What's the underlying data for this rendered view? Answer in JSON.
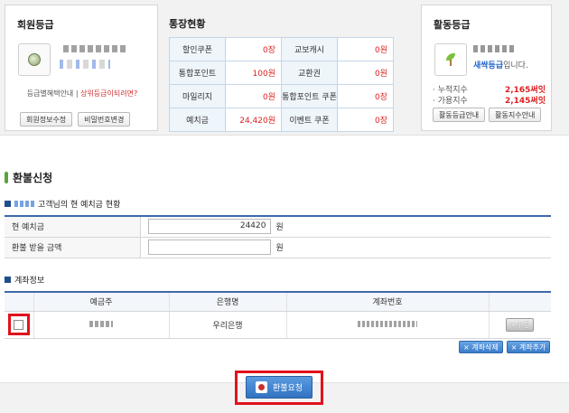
{
  "member_grade": {
    "title": "회원등급",
    "grade_info_link": "등급별혜택안내",
    "separator": "|",
    "upper_grade_link": "상위등급이되려면?",
    "edit_info_button": "회원정보수정",
    "change_password_button": "비밀번호변경"
  },
  "account_status": {
    "title": "통장현황",
    "rows": [
      {
        "label1": "할인쿠폰",
        "value1": "0장",
        "label2": "교보캐시",
        "value2": "0원"
      },
      {
        "label1": "통합포인트",
        "value1": "100원",
        "label2": "교환권",
        "value2": "0원"
      },
      {
        "label1": "마일리지",
        "value1": "0원",
        "label2": "통합포인트 쿠폰",
        "value2": "0장"
      },
      {
        "label1": "예치금",
        "value1": "24,420원",
        "label2": "이벤트 쿠폰",
        "value2": "0장"
      }
    ]
  },
  "activity_grade": {
    "title": "활동등급",
    "grade_name": "새싹등급",
    "grade_suffix": "입니다.",
    "cumulative_label": "· 누적지수",
    "cumulative_value": "2,165써잇",
    "available_label": "· 가용지수",
    "available_value": "2,145써잇",
    "grade_guide_button": "활동등급안내",
    "index_guide_button": "활동지수안내"
  },
  "refund": {
    "section_title": "환불신청",
    "deposit_status_title": "고객님의 현 예치금 현황",
    "current_deposit_label": "현 예치금",
    "current_deposit_value": "24420",
    "refund_amount_label": "환불 받을 금액",
    "refund_amount_value": "",
    "unit": "원"
  },
  "account_info": {
    "title": "계좌정보",
    "headers": [
      "예금주",
      "은행명",
      "계좌번호"
    ],
    "rows": [
      {
        "bank": "우리은행",
        "edit_button": "×수정"
      }
    ],
    "delete_button": "× 계좌삭제",
    "add_button": "× 계좌추가"
  },
  "submit": {
    "refund_request_button": "환불요청"
  },
  "colors": {
    "accent_blue": "#3c6aa9",
    "value_red": "#dd2222",
    "highlight_red": "#e0121e",
    "section_green": "#5aa33a"
  }
}
